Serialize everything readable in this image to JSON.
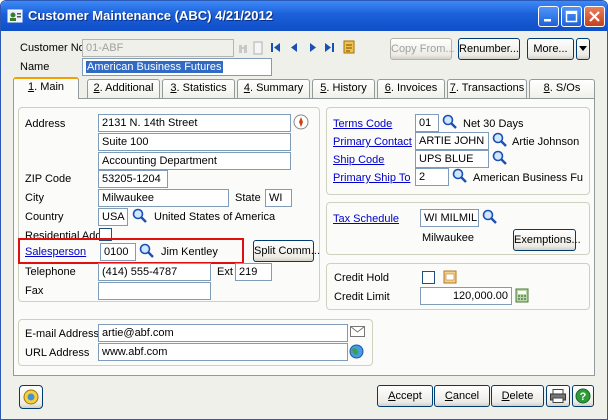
{
  "window": {
    "title": "Customer Maintenance (ABC) 4/21/2012"
  },
  "header": {
    "customer_no_label": "Customer No.",
    "customer_no_value": "01-ABF",
    "name_label": "Name",
    "name_value": "American Business Futures",
    "copy_from_label": "Copy From...",
    "renumber_label": "Renumber...",
    "more_label": "More..."
  },
  "tabs": [
    {
      "num": "1",
      "label": ". Main"
    },
    {
      "num": "2",
      "label": ". Additional"
    },
    {
      "num": "3",
      "label": ". Statistics"
    },
    {
      "num": "4",
      "label": ". Summary"
    },
    {
      "num": "5",
      "label": ". History"
    },
    {
      "num": "6",
      "label": ". Invoices"
    },
    {
      "num": "7",
      "label": ". Transactions"
    },
    {
      "num": "8",
      "label": ". S/Os"
    }
  ],
  "address": {
    "address_label": "Address",
    "line1": "2131 N. 14th Street",
    "line2": "Suite 100",
    "line3": "Accounting Department",
    "zip_label": "ZIP Code",
    "zip_value": "53205-1204",
    "city_label": "City",
    "city_value": "Milwaukee",
    "state_label": "State",
    "state_value": "WI",
    "country_label": "Country",
    "country_value": "USA",
    "country_name": "United States of America",
    "residential_label": "Residential Addr",
    "salesperson_label": "Salesperson",
    "salesperson_value": "0100",
    "salesperson_name": "Jim Kentley",
    "split_comm_label": "Split Comm...",
    "telephone_label": "Telephone",
    "telephone_value": "(414) 555-4787",
    "ext_label": "Ext",
    "ext_value": "219",
    "fax_label": "Fax",
    "fax_value": ""
  },
  "terms": {
    "terms_code_label": "Terms Code",
    "terms_code_value": "01",
    "terms_desc": "Net 30 Days",
    "primary_contact_label": "Primary Contact",
    "primary_contact_value": "ARTIE JOHN",
    "primary_contact_name": "Artie Johnson",
    "ship_code_label": "Ship Code",
    "ship_code_value": "UPS BLUE",
    "primary_ship_to_label": "Primary Ship To",
    "primary_ship_to_value": "2",
    "primary_ship_to_name": "American Business Futur"
  },
  "tax": {
    "tax_schedule_label": "Tax Schedule",
    "tax_schedule_value": "WI MILMIL",
    "tax_schedule_desc": "Milwaukee",
    "exemptions_label": "Exemptions..."
  },
  "credit": {
    "credit_hold_label": "Credit Hold",
    "credit_limit_label": "Credit Limit",
    "credit_limit_value": "120,000.00"
  },
  "contact": {
    "email_label": "E-mail Address",
    "email_value": "artie@abf.com",
    "url_label": "URL Address",
    "url_value": "www.abf.com"
  },
  "footer": {
    "accept_label": "ccept",
    "accept_key": "A",
    "cancel_label": "ancel",
    "cancel_key": "C",
    "delete_label": "elete",
    "delete_key": "D"
  },
  "colors": {
    "titlebar": "#1b5fd9",
    "link": "#0000cc",
    "highlight": "#e01010",
    "selection": "#316ac5"
  }
}
